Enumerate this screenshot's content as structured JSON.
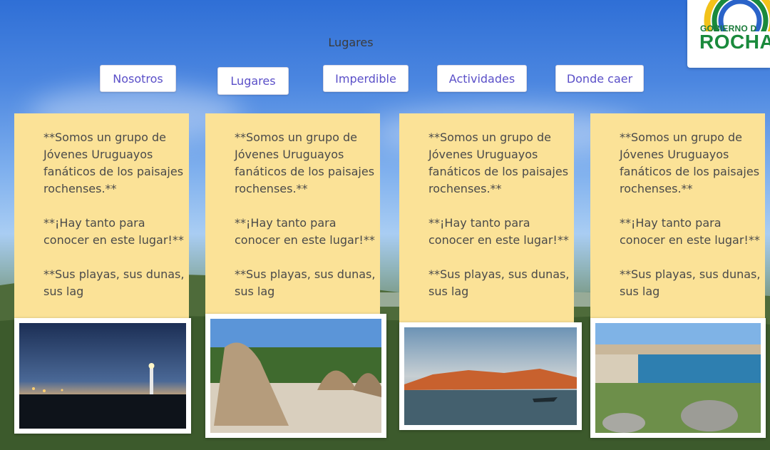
{
  "header": {
    "title": "Lugares"
  },
  "logo": {
    "line1": "GOBIERNO D",
    "line2": "ROCHA"
  },
  "nav": {
    "items": [
      {
        "label": "Nosotros"
      },
      {
        "label": "Lugares"
      },
      {
        "label": "Imperdible"
      },
      {
        "label": "Actividades"
      },
      {
        "label": "Donde caer"
      }
    ]
  },
  "cards": [
    {
      "p1": "**Somos un grupo de Jóvenes Uruguayos fanáticos de los paisajes rochenses.**",
      "p2": "**¡Hay tanto para conocer en este lugar!**",
      "p3": "**Sus playas, sus dunas, sus lag",
      "image": "lighthouse-night-photo"
    },
    {
      "p1": "**Somos un grupo de Jóvenes Uruguayos fanáticos de los paisajes rochenses.**",
      "p2": "**¡Hay tanto para conocer en este lugar!**",
      "p3": "**Sus playas, sus dunas, sus lag",
      "image": "rock-formations-photo"
    },
    {
      "p1": "**Somos un grupo de Jóvenes Uruguayos fanáticos de los paisajes rochenses.**",
      "p2": "**¡Hay tanto para conocer en este lugar!**",
      "p3": "**Sus playas, sus dunas, sus lag",
      "image": "lagoon-sunset-photo"
    },
    {
      "p1": "**Somos un grupo de Jóvenes Uruguayos fanáticos de los paisajes rochenses.**",
      "p2": "**¡Hay tanto para conocer en este lugar!**",
      "p3": "**Sus playas, sus dunas, sus lag",
      "image": "coastal-town-photo"
    }
  ],
  "colors": {
    "accent": "#5a4fc8",
    "card_bg": "#fbe297",
    "logo_green": "#1a8a3c"
  }
}
